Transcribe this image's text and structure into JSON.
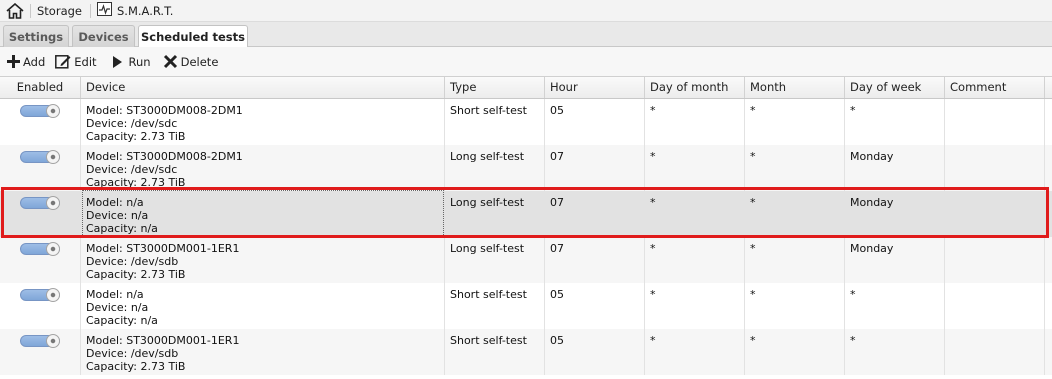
{
  "breadcrumb": {
    "storage_label": "Storage",
    "smart_label": "S.M.A.R.T."
  },
  "tabs": [
    {
      "label": "Settings"
    },
    {
      "label": "Devices"
    },
    {
      "label": "Scheduled tests",
      "active": true
    }
  ],
  "toolbar": {
    "add_label": "Add",
    "edit_label": "Edit",
    "run_label": "Run",
    "delete_label": "Delete"
  },
  "columns": {
    "enabled": "Enabled",
    "device": "Device",
    "type": "Type",
    "hour": "Hour",
    "day_of_month": "Day of month",
    "month": "Month",
    "day_of_week": "Day of week",
    "comment": "Comment"
  },
  "rows": [
    {
      "enabled": true,
      "model": "Model: ST3000DM008-2DM1",
      "device": "Device: /dev/sdc",
      "capacity": "Capacity: 2.73 TiB",
      "type": "Short self-test",
      "hour": "05",
      "day_of_month": "*",
      "month": "*",
      "day_of_week": "*",
      "comment": ""
    },
    {
      "enabled": true,
      "model": "Model: ST3000DM008-2DM1",
      "device": "Device: /dev/sdc",
      "capacity": "Capacity: 2.73 TiB",
      "type": "Long self-test",
      "hour": "07",
      "day_of_month": "*",
      "month": "*",
      "day_of_week": "Monday",
      "comment": ""
    },
    {
      "enabled": true,
      "model": "Model: n/a",
      "device": "Device: n/a",
      "capacity": "Capacity: n/a",
      "type": "Long self-test",
      "hour": "07",
      "day_of_month": "*",
      "month": "*",
      "day_of_week": "Monday",
      "comment": "",
      "selected": true
    },
    {
      "enabled": true,
      "model": "Model: ST3000DM001-1ER1",
      "device": "Device: /dev/sdb",
      "capacity": "Capacity: 2.73 TiB",
      "type": "Long self-test",
      "hour": "07",
      "day_of_month": "*",
      "month": "*",
      "day_of_week": "Monday",
      "comment": ""
    },
    {
      "enabled": true,
      "model": "Model: n/a",
      "device": "Device: n/a",
      "capacity": "Capacity: n/a",
      "type": "Short self-test",
      "hour": "05",
      "day_of_month": "*",
      "month": "*",
      "day_of_week": "*",
      "comment": ""
    },
    {
      "enabled": true,
      "model": "Model: ST3000DM001-1ER1",
      "device": "Device: /dev/sdb",
      "capacity": "Capacity: 2.73 TiB",
      "type": "Short self-test",
      "hour": "05",
      "day_of_month": "*",
      "month": "*",
      "day_of_week": "*",
      "comment": ""
    }
  ],
  "colors": {
    "highlight": "#e01b1b",
    "toggle_on": "#8fb2e0"
  }
}
